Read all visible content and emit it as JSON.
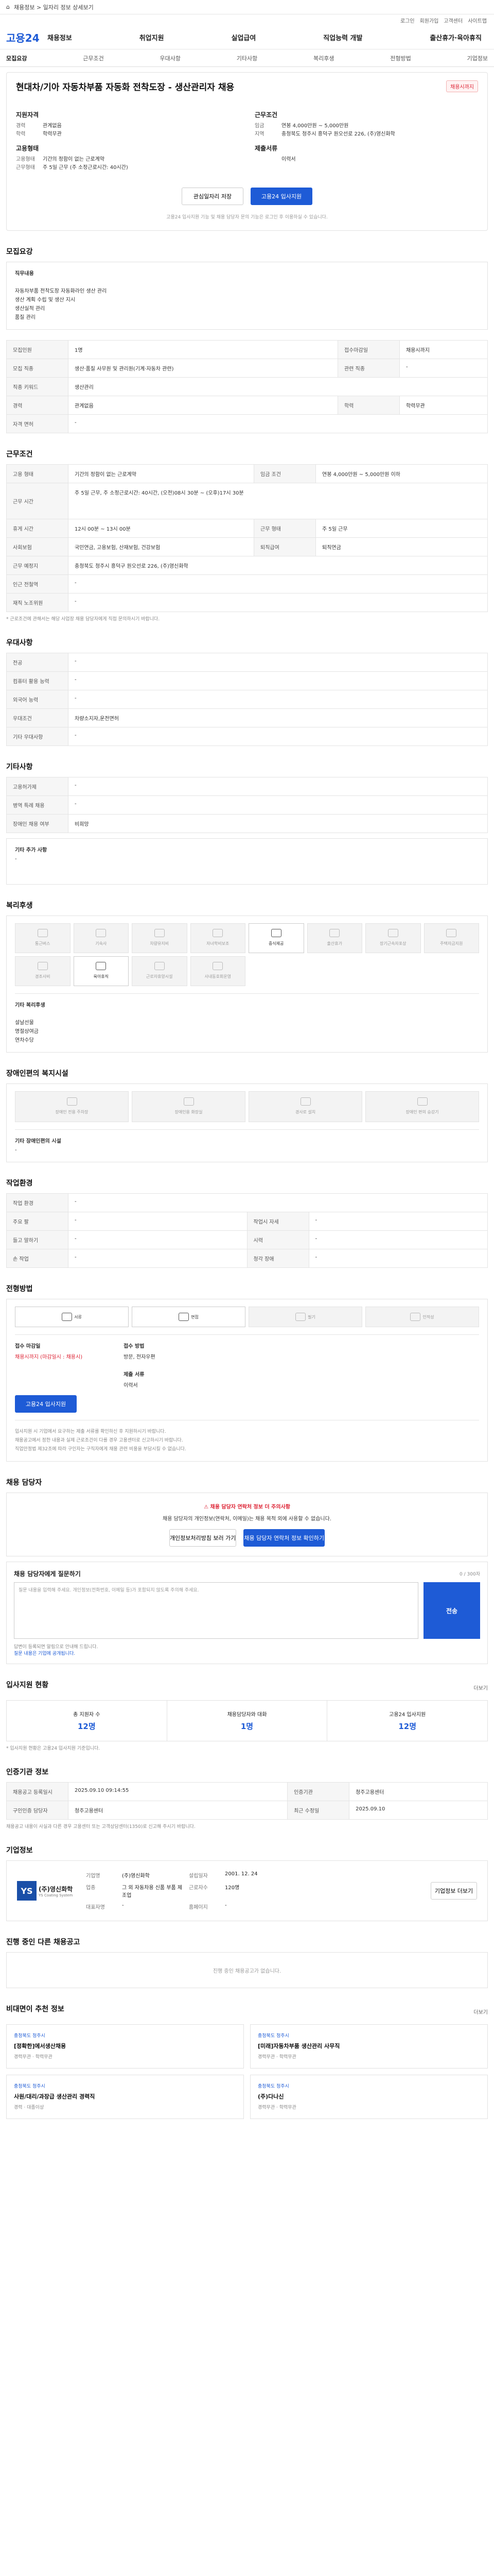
{
  "topbar": {
    "home": "⌂",
    "path": "채용정보 > 일자리 정보 상세보기"
  },
  "subbar": {
    "items": [
      "로그인",
      "회원가입",
      "고객센터",
      "사이트맵"
    ]
  },
  "gnb": {
    "logo": "고용24",
    "menu": [
      "채용정보",
      "취업지원",
      "실업급여",
      "직업능력 개발",
      "출산휴가·육아휴직"
    ]
  },
  "tabs": [
    "모집요강",
    "근무조건",
    "우대사항",
    "기타사항",
    "복리후생",
    "전형방법",
    "기업정보"
  ],
  "job": {
    "title": "현대차/기아 자동차부품 자동화 전착도장 - 생산관리자 채용",
    "badge": "채용시까지",
    "left_title": "지원자격",
    "left": [
      [
        "경력",
        "관계없음"
      ],
      [
        "학력",
        "학력무관"
      ]
    ],
    "left2_title": "고용형태",
    "left2": [
      [
        "고용형태",
        "기간의 정함이 없는 근로계약"
      ],
      [
        "근무형태",
        "주 5일 근무 (주 소정근로시간: 40시간)"
      ]
    ],
    "right_title": "근무조건",
    "right": [
      [
        "임금",
        "연봉 4,000만원 ~ 5,000만원"
      ],
      [
        "지역",
        "충청북도 청주시 흥덕구 원오선로 226, (주)영신화학"
      ]
    ],
    "right2_title": "제출서류",
    "right2": [
      [
        "",
        "이력서"
      ]
    ],
    "btn_save": "관심일자리 저장",
    "btn_apply": "고용24 입사지원",
    "note": "고용24 입사지원 기능 및 채용 담당자 문의 기능은 로그인 후 이용하실 수 있습니다."
  },
  "recruit": {
    "heading": "모집요강",
    "duty_title": "직무내용",
    "duty": [
      "자동차부품 전착도장 자동화라인 생산 관리",
      "생산 계획 수립 및 생산 지시",
      "생산실적 관리",
      "품질 관리"
    ],
    "rows": [
      [
        "모집인원",
        "1명",
        "접수마감일",
        "채용시까지"
      ],
      [
        "모집 직종",
        "생산·품질 사무원 및 관리원(기계·자동차 관련)",
        "관련 직종",
        "-"
      ],
      [
        "직종 키워드",
        "생산관리",
        "",
        ""
      ],
      [
        "경력",
        "관계없음",
        "학력",
        "학력무관"
      ],
      [
        "자격 면허",
        "-",
        "",
        ""
      ]
    ]
  },
  "cond": {
    "heading": "근무조건",
    "rows": [
      [
        "고용 형태",
        "기간의 정함이 없는 근로계약",
        "임금 조건",
        "연봉 4,000만원 ~ 5,000만원 이하"
      ],
      [
        "근무 시간",
        "주 5일 근무, 주 소정근로시간: 40시간, (오전)08시 30분 ~ (오후)17시 30분",
        "",
        ""
      ],
      [
        "휴게 시간",
        "12시 00분 ~ 13시 00분",
        "근무 형태",
        "주 5일 근무"
      ],
      [
        "사회보험",
        "국민연금, 고용보험, 산재보험, 건강보험",
        "퇴직급여",
        "퇴직연금"
      ],
      [
        "근무 예정지",
        "충청북도 청주시 흥덕구 원오선로 226, (주)영신화학",
        "",
        ""
      ],
      [
        "인근 전철역",
        "-",
        "",
        ""
      ],
      [
        "재직 노조위원",
        "-",
        "",
        ""
      ]
    ],
    "note": "* 근로조건에 관해서는 해당 사업장 채용 담당자에게 직접 문의하시기 바랍니다."
  },
  "pref": {
    "heading": "우대사항",
    "rows": [
      [
        "전공",
        "-"
      ],
      [
        "컴퓨터 활용 능력",
        "-"
      ],
      [
        "외국어 능력",
        "-"
      ],
      [
        "우대조건",
        "차량소지자,운전면허"
      ],
      [
        "기타 우대사항",
        "-"
      ]
    ]
  },
  "etc": {
    "heading": "기타사항",
    "rows": [
      [
        "고용허가제",
        "-"
      ],
      [
        "병역 특례 채용",
        "-"
      ],
      [
        "장애인 채용 여부",
        "비희망"
      ]
    ],
    "extra_title": "기타 추가 사항",
    "extra": "-"
  },
  "welfare": {
    "heading": "복리후생",
    "items": [
      "통근버스",
      "기숙사",
      "차량유지비",
      "자녀학비보조",
      "중식제공",
      "출산휴가",
      "장기근속자포상",
      "주택자금지원",
      "경조사비",
      "육아휴직",
      "근로자휴양시설",
      "사내동호회운영"
    ],
    "active": [
      4,
      9
    ],
    "other_title": "기타 복리후생",
    "other": [
      "설날선물",
      "명절상여금",
      "연차수당"
    ]
  },
  "disability": {
    "heading": "장애인편의 복지시설",
    "items": [
      "장애인 전용 주차장",
      "장애인용 화장실",
      "경사로 설치",
      "장애인 편의 승강기"
    ],
    "other_title": "기타 장애인편의 시설",
    "other": "-"
  },
  "workplace": {
    "heading": "작업환경",
    "rows": [
      [
        "작업 환경",
        "-",
        "",
        ""
      ],
      [
        "주요 팔",
        "-",
        "작업시 자세",
        "-"
      ],
      [
        "들고 말하기",
        "-",
        "시력",
        "-"
      ],
      [
        "손 작업",
        "-",
        "청각 장애",
        "-"
      ]
    ]
  },
  "process": {
    "heading": "전형방법",
    "methods": [
      "서류",
      "면접",
      "필기",
      "인적성"
    ],
    "active": [
      0,
      1
    ],
    "deadline_label": "접수 마감일",
    "deadline": "채용시까지 (마감일시 : 채용시)",
    "method_label": "접수 방법",
    "method": "방문, 전자우편",
    "docs_label": "제출 서류",
    "docs": "이력서",
    "apply_btn": "고용24 입사지원",
    "notes": [
      "입사지원 시 기업에서 요구하는 제출 서류를 확인하신 후 지원하시기 바랍니다.",
      "채용공고에서 정한 내용과 실제 근로조건이 다를 경우 고용센터로 신고하시기 바랍니다.",
      "직업안정법 제32조에 따라 구인자는 구직자에게 채용 관련 비용을 부담시킬 수 없습니다."
    ]
  },
  "contact": {
    "heading": "채용 담당자",
    "alert_title": "채용 담당자 연락처 정보 더 주의사항",
    "alert_body": "채용 담당자의 개인정보(연락처, 이메일)는 채용 목적 외에 사용할 수 없습니다.",
    "btn1": "개인정보처리방침 보러 가기",
    "btn2": "채용 담당자 연락처 정보 확인하기",
    "q_title": "채용 담당자에게 질문하기",
    "q_count": "0 / 300자",
    "q_placeholder": "질문 내용을 입력해 주세요. 개인정보(전화번호, 이메일 등)가 포함되지 않도록 주의해 주세요.",
    "q_btn": "전송",
    "q_notes": [
      "답변이 등록되면 알림으로 안내해 드립니다.",
      "질문 내용은 기업에 공개됩니다."
    ]
  },
  "status": {
    "heading": "입사지원 현황",
    "more": "더보기",
    "items": [
      [
        "총 지원자 수",
        "12명"
      ],
      [
        "채용담당자와 대화",
        "1명"
      ],
      [
        "고용24 입사지원",
        "12명"
      ]
    ],
    "note": "* 입사지원 현황은 고용24 입사지원 기준입니다."
  },
  "agency": {
    "heading": "인증기관 정보",
    "rows": [
      [
        "채용공고 등록일시",
        "2025.09.10 09:14:55",
        "인증기관",
        "청주고용센터"
      ],
      [
        "구인인증 담당자",
        "청주고용센터",
        "최근 수정일",
        "2025.09.10"
      ]
    ],
    "notes": [
      "채용공고 내용이 사실과 다른 경우 고용센터 또는 고객상담센터(1350)로 신고해 주시기 바랍니다."
    ]
  },
  "company": {
    "heading": "기업정보",
    "logo_mark": "YS",
    "logo_text": "(주)영신화학",
    "logo_sub": "YS Coating System",
    "info": [
      [
        "기업명",
        "(주)영신화학"
      ],
      [
        "설립일자",
        "2001. 12. 24"
      ],
      [
        "업종",
        "그 외 자동차용 신품 부품 제조업"
      ],
      [
        "근로자수",
        "120명"
      ],
      [
        "대표자명",
        "-"
      ],
      [
        "홈페이지",
        "-"
      ]
    ],
    "btn": "기업정보 더보기"
  },
  "other_jobs": {
    "heading": "진행 중인 다른 채용공고",
    "empty": "진행 중인 채용공고가 없습니다."
  },
  "recommend": {
    "heading": "비대면이 추천 정보",
    "more": "더보기",
    "cards": [
      {
        "tag": "충청북도 청주시",
        "name": "[정확한]에서생산채용",
        "meta": "경력무관 · 학력무관"
      },
      {
        "tag": "충청북도 청주시",
        "name": "[미래]자동차부품 생산관리 사무직",
        "meta": "경력무관 · 학력무관"
      },
      {
        "tag": "충청북도 청주시",
        "name": "사원/대리/과장급 생산관리 경력직",
        "meta": "경력 · 대졸이상"
      },
      {
        "tag": "충청북도 청주시",
        "name": "(주)다나신",
        "meta": "경력무관 · 학력무관"
      }
    ]
  }
}
